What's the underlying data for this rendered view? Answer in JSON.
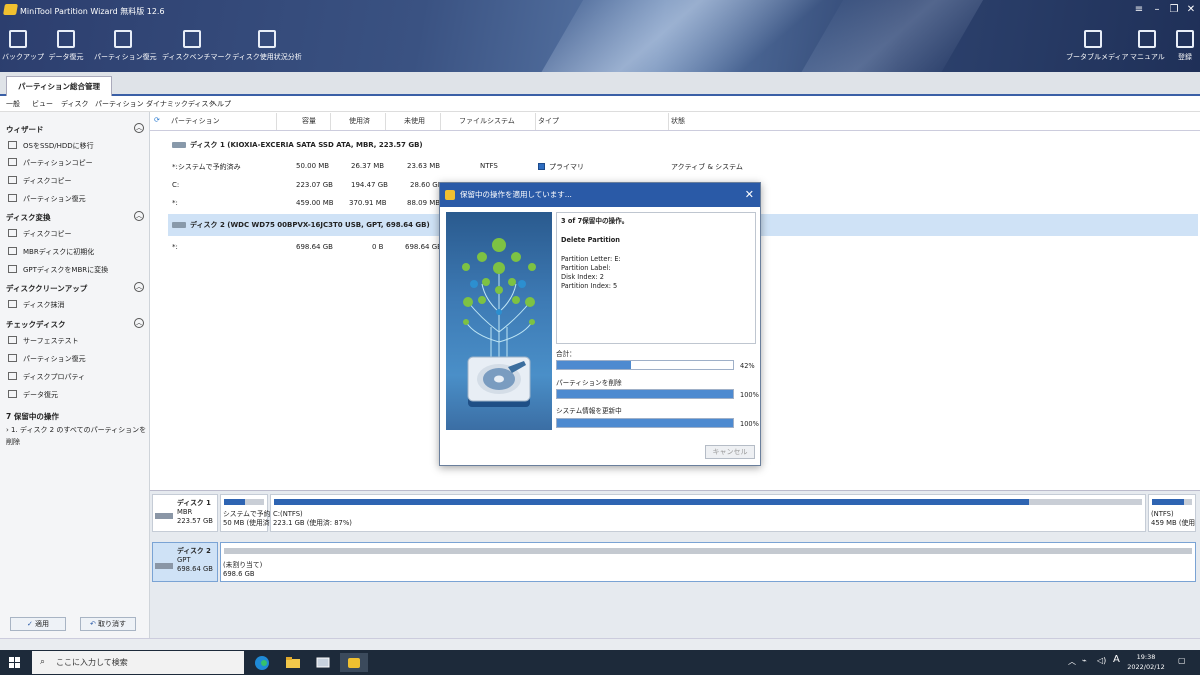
{
  "window": {
    "title": "MiniTool Partition Wizard 無料版 12.6"
  },
  "toolbar": {
    "items": [
      "バックアップ",
      "データ復元",
      "パーティション復元",
      "ディスクベンチマーク",
      "ディスク使用状況分析"
    ],
    "right_items": [
      "ブータブルメディア",
      "マニュアル",
      "登録"
    ]
  },
  "tabs": {
    "main": "パーティション総合管理"
  },
  "menu": {
    "items": [
      "一般",
      "ビュー",
      "ディスク",
      "パーティション",
      "ダイナミックディスク",
      "ヘルプ"
    ]
  },
  "sidebar": {
    "sections": [
      {
        "title": "ウィザード",
        "items": [
          "OSをSSD/HDDに移行",
          "パーティションコピー",
          "ディスクコピー",
          "パーティション復元"
        ]
      },
      {
        "title": "ディスク変換",
        "items": [
          "ディスクコピー",
          "MBRディスクに初期化",
          "GPTディスクをMBRに変換"
        ]
      },
      {
        "title": "ディスククリーンアップ",
        "items": [
          "ディスク抹消"
        ]
      },
      {
        "title": "チェックディスク",
        "items": [
          "サーフェステスト",
          "パーティション復元",
          "ディスクプロパティ",
          "データ復元"
        ]
      }
    ],
    "pending": {
      "title": "7 保留中の操作",
      "items": [
        "1. ディスク 2 のすべてのパーティションを削除"
      ]
    },
    "apply_label": "適用",
    "undo_label": "取り消す"
  },
  "table": {
    "headers": [
      "パーティション",
      "容量",
      "使用済",
      "未使用",
      "ファイルシステム",
      "タイプ",
      "状態"
    ],
    "disk1": "ディスク 1 (KIOXIA-EXCERIA SATA SSD ATA, MBR, 223.57 GB)",
    "disk1_rows": [
      {
        "name": "*:システムで予約済み",
        "capacity": "50.00 MB",
        "used": "26.37 MB",
        "unused": "23.63 MB",
        "fs": "NTFS",
        "type": "プライマリ",
        "status": "アクティブ & システム"
      },
      {
        "name": "C:",
        "capacity": "223.07 GB",
        "used": "194.47 GB",
        "unused": "28.60 GB"
      },
      {
        "name": "*:",
        "capacity": "459.00 MB",
        "used": "370.91 MB",
        "unused": "88.09 MB"
      }
    ],
    "disk2": "ディスク 2 (WDC WD75 00BPVX-16JC3T0 USB, GPT, 698.64 GB)",
    "disk2_rows": [
      {
        "name": "*:",
        "capacity": "698.64 GB",
        "used": "0 B",
        "unused": "698.64 GB"
      }
    ]
  },
  "diskmap": {
    "disk1": {
      "name": "ディスク 1",
      "style": "MBR",
      "size": "223.57 GB",
      "parts": [
        {
          "label": "システムで予約",
          "detail": "50 MB (使用済",
          "fill": 0.53
        },
        {
          "label": "C:(NTFS)",
          "detail": "223.1 GB (使用済: 87%)",
          "fill": 0.87
        },
        {
          "label": "(NTFS)",
          "detail": "459 MB (使用",
          "fill": 0.81
        }
      ]
    },
    "disk2": {
      "name": "ディスク 2",
      "style": "GPT",
      "size": "698.64 GB",
      "parts": [
        {
          "label": "(未割り当て)",
          "detail": "698.6 GB",
          "fill": 0
        }
      ]
    }
  },
  "dialog": {
    "title": "保留中の操作を適用しています...",
    "step": "3 of 7保留中の操作。",
    "operation": "Delete Partition",
    "details": [
      "Partition Letter: E:",
      "Partition Label:",
      "Disk Index: 2",
      "Partition Index: 5"
    ],
    "progress": [
      {
        "label": "合計：",
        "value": "42%",
        "fraction": 0.42
      },
      {
        "label": "パーティションを削除",
        "value": "100%",
        "fraction": 1.0
      },
      {
        "label": "システム情報を更新中",
        "value": "100%",
        "fraction": 1.0
      }
    ],
    "cancel_label": "キャンセル"
  },
  "taskbar": {
    "search_placeholder": "ここに入力して検索",
    "time": "19:38",
    "date": "2022/02/12",
    "ime": "A"
  },
  "colors": {
    "accent": "#2a5aa7",
    "primary_partition": "#2d6cc0",
    "selected_row": "#cfe2f6"
  }
}
